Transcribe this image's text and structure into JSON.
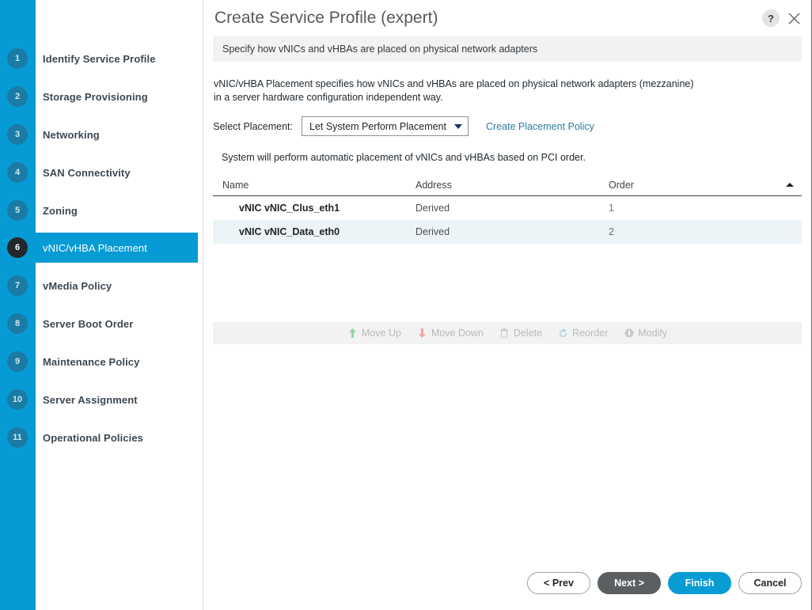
{
  "dialog": {
    "title": "Create Service Profile (expert)",
    "help_label": "?",
    "close_label": "close-icon",
    "subheader": "Specify how vNICs and vHBAs are placed on physical network adapters"
  },
  "sidebar": {
    "steps": [
      {
        "number": "1",
        "label": "Identify Service Profile",
        "selected": false
      },
      {
        "number": "2",
        "label": "Storage Provisioning",
        "selected": false
      },
      {
        "number": "3",
        "label": "Networking",
        "selected": false
      },
      {
        "number": "4",
        "label": "SAN Connectivity",
        "selected": false
      },
      {
        "number": "5",
        "label": "Zoning",
        "selected": false
      },
      {
        "number": "6",
        "label": "vNIC/vHBA Placement",
        "selected": true
      },
      {
        "number": "7",
        "label": "vMedia Policy",
        "selected": false
      },
      {
        "number": "8",
        "label": "Server Boot Order",
        "selected": false
      },
      {
        "number": "9",
        "label": "Maintenance Policy",
        "selected": false
      },
      {
        "number": "10",
        "label": "Server Assignment",
        "selected": false
      },
      {
        "number": "11",
        "label": "Operational Policies",
        "selected": false
      }
    ]
  },
  "main": {
    "description": "vNIC/vHBA Placement specifies how vNICs and vHBAs are placed on physical network adapters (mezzanine)\nin a server hardware configuration independent way.",
    "placement_label": "Select Placement:",
    "placement_value": "Let System Perform Placement",
    "create_policy_link": "Create Placement Policy",
    "note": "System will perform automatic placement of vNICs and vHBAs based on PCI order."
  },
  "table": {
    "columns": [
      "Name",
      "Address",
      "Order"
    ],
    "sort": "ascending",
    "rows": [
      {
        "name": "vNIC vNIC_Clus_eth1",
        "address": "Derived",
        "order": "1"
      },
      {
        "name": "vNIC vNIC_Data_eth0",
        "address": "Derived",
        "order": "2"
      }
    ]
  },
  "toolbar": {
    "items": [
      {
        "label": "Move Up",
        "icon": "arrow-up-icon",
        "enabled": false
      },
      {
        "label": "Move Down",
        "icon": "arrow-down-icon",
        "enabled": false
      },
      {
        "label": "Delete",
        "icon": "trash-icon",
        "enabled": false
      },
      {
        "label": "Reorder",
        "icon": "reorder-icon",
        "enabled": false
      },
      {
        "label": "Modify",
        "icon": "info-icon",
        "enabled": false
      }
    ]
  },
  "footer": {
    "prev": "< Prev",
    "next": "Next >",
    "finish": "Finish",
    "cancel": "Cancel"
  },
  "colors": {
    "rail_blue": "#069bd4",
    "accent": "#089bd4",
    "link": "#2c7b9e",
    "selected_badge": "#24282c",
    "row_alt": "#edf4f8",
    "arrow_up": "#8fd6a8",
    "arrow_down": "#f0a79c",
    "reorder": "#a9cfe4"
  }
}
